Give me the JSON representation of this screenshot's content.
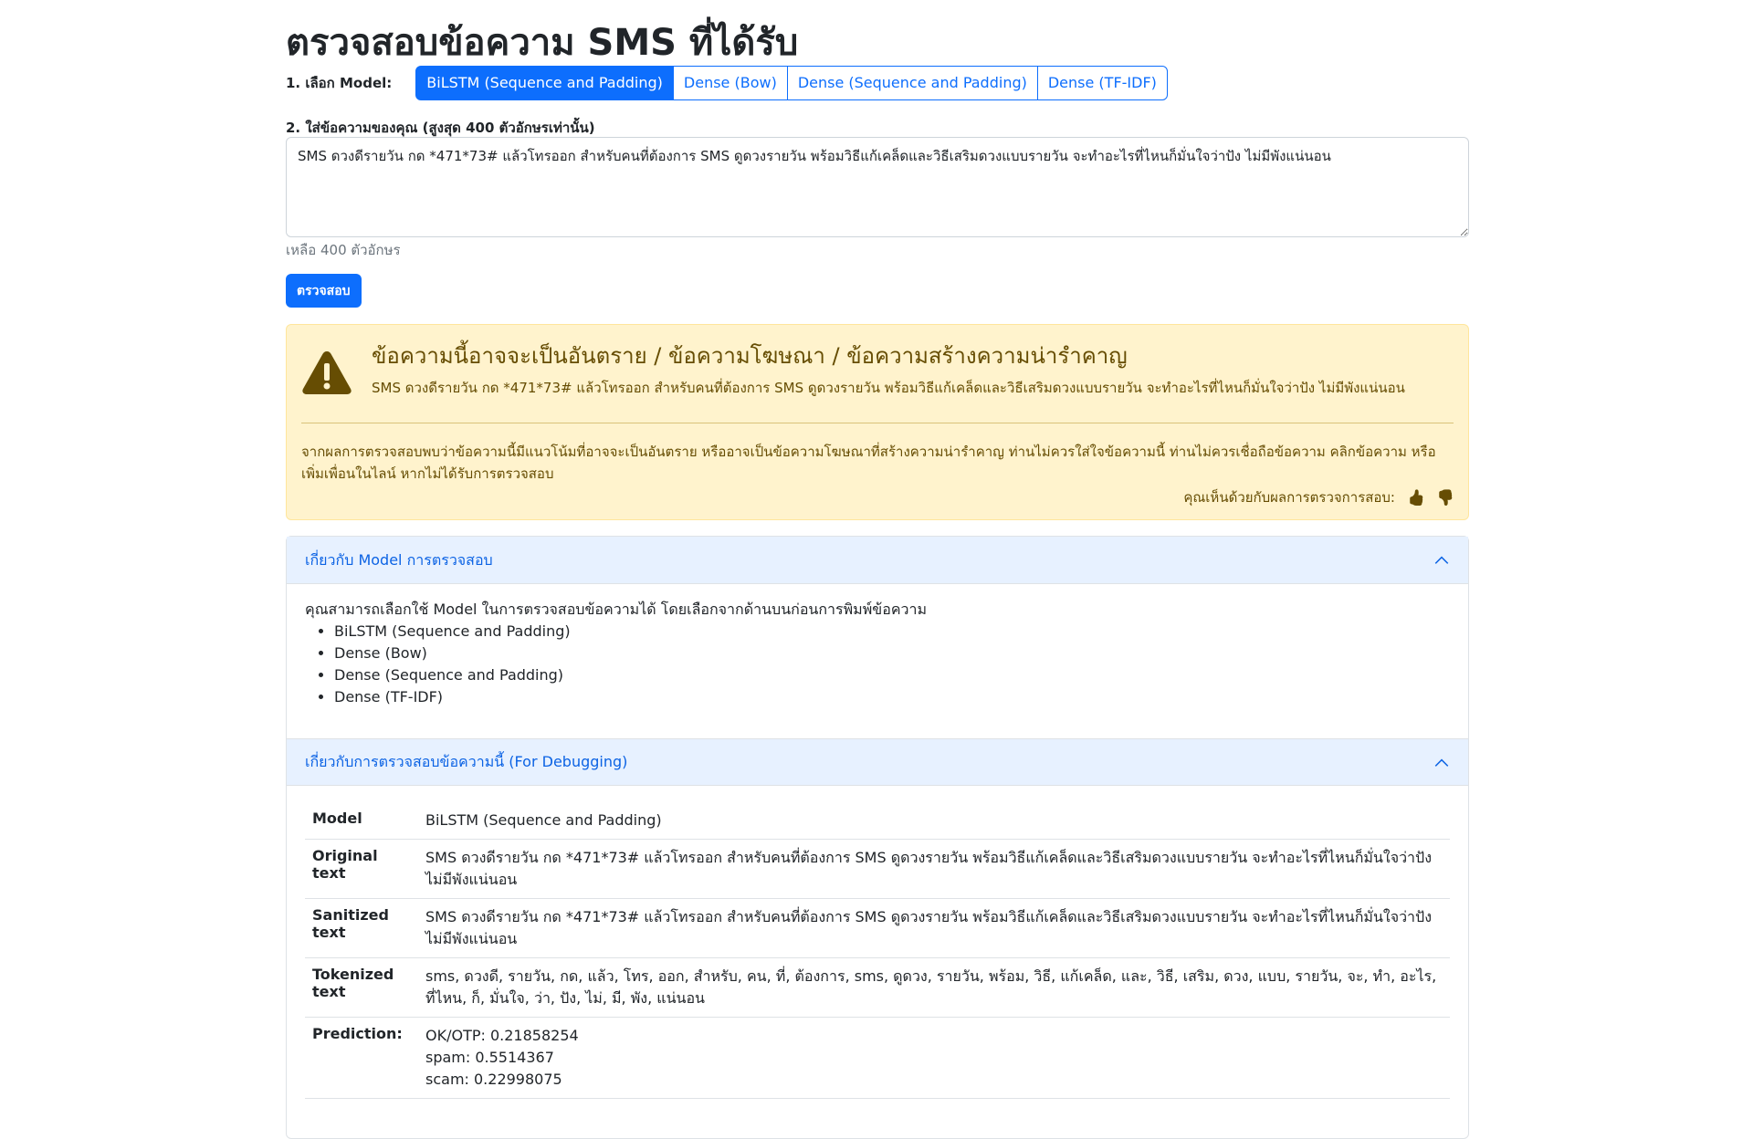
{
  "page": {
    "title": "ตรวจสอบข้อความ SMS ที่ได้รับ"
  },
  "model_select": {
    "label": "1. เลือก Model:",
    "options": [
      {
        "label": "BiLSTM (Sequence and Padding)",
        "active": true
      },
      {
        "label": "Dense (Bow)",
        "active": false
      },
      {
        "label": "Dense (Sequence and Padding)",
        "active": false
      },
      {
        "label": "Dense (TF-IDF)",
        "active": false
      }
    ]
  },
  "input": {
    "label": "2. ใส่ข้อความของคุณ (สูงสุด 400 ตัวอักษรเท่านั้น)",
    "value": "SMS ดวงดีรายวัน กด *471*73# แล้วโทรออก สำหรับคนที่ต้องการ SMS ดูดวงรายวัน พร้อมวิธีแก้เคล็ดและวิธีเสริมดวงแบบรายวัน จะทำอะไรที่ไหนก็มั่นใจว่าปัง ไม่มีพังแน่นอน",
    "remaining": "เหลือ 400 ตัวอักษร",
    "submit_label": "ตรวจสอบ"
  },
  "result_alert": {
    "heading": "ข้อความนี้อาจจะเป็นอันตราย / ข้อความโฆษณา / ข้อความสร้างความน่ารำคาญ",
    "message": "SMS ดวงดีรายวัน กด *471*73# แล้วโทรออก สำหรับคนที่ต้องการ SMS ดูดวงรายวัน พร้อมวิธีแก้เคล็ดและวิธีเสริมดวงแบบรายวัน จะทำอะไรที่ไหนก็มั่นใจว่าปัง ไม่มีพังแน่นอน",
    "advice": "จากผลการตรวจสอบพบว่าข้อความนี้มีแนวโน้มที่อาจจะเป็นอันตราย หรืออาจเป็นข้อความโฆษณาที่สร้างความน่ารำคาญ ท่านไม่ควรใส่ใจข้อความนี้ ท่านไม่ควรเชื่อถือข้อความ คลิกข้อความ หรือเพิ่มเพื่อนในไลน์ หากไม่ได้รับการตรวจสอบ",
    "feedback_label": "คุณเห็นด้วยกับผลการตรวจการสอบ:",
    "icons": {
      "agree": "thumbs-up-icon",
      "disagree": "thumbs-down-icon",
      "warning": "warning-triangle-icon"
    },
    "colors": {
      "background": "#fff3cd",
      "text": "#664d03"
    }
  },
  "accordion_models": {
    "header": "เกี่ยวกับ Model การตรวจสอบ",
    "intro": "คุณสามารถเลือกใช้ Model ในการตรวจสอบข้อความได้ โดยเลือกจากด้านบนก่อนการพิมพ์ข้อความ",
    "items": [
      "BiLSTM (Sequence and Padding)",
      "Dense (Bow)",
      "Dense (Sequence and Padding)",
      "Dense (TF-IDF)"
    ]
  },
  "accordion_debug": {
    "header": "เกี่ยวกับการตรวจสอบข้อความนี้ (For Debugging)",
    "rows": {
      "model": {
        "label": "Model",
        "value": "BiLSTM (Sequence and Padding)"
      },
      "original": {
        "label": "Original text",
        "value": "SMS ดวงดีรายวัน กด *471*73# แล้วโทรออก สำหรับคนที่ต้องการ SMS ดูดวงรายวัน พร้อมวิธีแก้เคล็ดและวิธีเสริมดวงแบบรายวัน จะทำอะไรที่ไหนก็มั่นใจว่าปัง ไม่มีพังแน่นอน"
      },
      "sanitized": {
        "label": "Sanitized text",
        "value": "SMS ดวงดีรายวัน กด *471*73# แล้วโทรออก สำหรับคนที่ต้องการ SMS ดูดวงรายวัน พร้อมวิธีแก้เคล็ดและวิธีเสริมดวงแบบรายวัน จะทำอะไรที่ไหนก็มั่นใจว่าปัง ไม่มีพังแน่นอน"
      },
      "tokenized": {
        "label": "Tokenized text",
        "value": "sms, ดวงดี, รายวัน, กด, แล้ว, โทร, ออก, สำหรับ, คน, ที่, ต้องการ, sms, ดูดวง, รายวัน, พร้อม, วิธี, แก้เคล็ด, และ, วิธี, เสริม, ดวง, แบบ, รายวัน, จะ, ทำ, อะไร, ที่ไหน, ก็, มั่นใจ, ว่า, ปัง, ไม่, มี, พัง, แน่นอน"
      },
      "prediction": {
        "label": "Prediction:",
        "values": [
          "OK/OTP: 0.21858254",
          "spam: 0.5514367",
          "scam: 0.22998075"
        ]
      }
    }
  },
  "colors": {
    "primary": "#0d6efd",
    "accordion_header_bg": "#e7f1ff",
    "accordion_header_text": "#0c63e4"
  }
}
